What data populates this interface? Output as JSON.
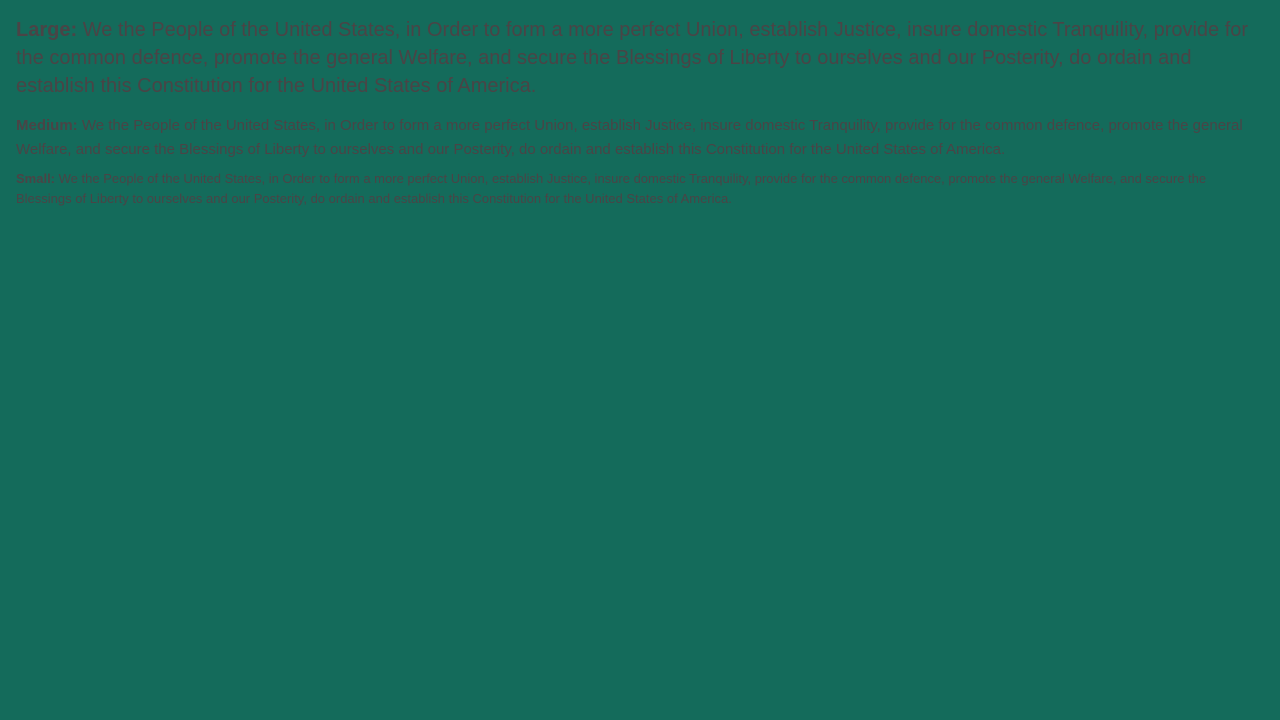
{
  "samples": {
    "large": {
      "label": "Large:",
      "text": "We the People of the United States, in Order to form a more perfect Union, establish Justice, insure domestic Tranquility, provide for the common defence, promote the general Welfare, and secure the Blessings of Liberty to ourselves and our Posterity, do ordain and establish this Constitution for the United States of America."
    },
    "medium": {
      "label": "Medium:",
      "text": "We the People of the United States, in Order to form a more perfect Union, establish Justice, insure domestic Tranquility, provide for the common defence, promote the general Welfare, and secure the Blessings of Liberty to ourselves and our Posterity, do ordain and establish this Constitution for the United States of America."
    },
    "small": {
      "label": "Small:",
      "text": "We the People of the United States, in Order to form a more perfect Union, establish Justice, insure domestic Tranquility, provide for the common defence, promote the general Welfare, and secure the Blessings of Liberty to ourselves and our Posterity, do ordain and establish this Constitution for the United States of America."
    }
  },
  "colors": {
    "background": "#146b5b",
    "text": "#4a4446"
  }
}
